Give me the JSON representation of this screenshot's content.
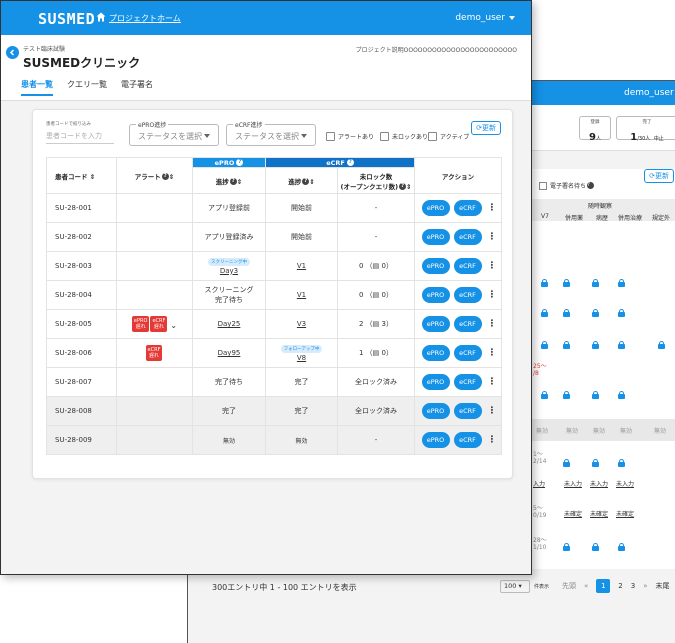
{
  "back": {
    "user": "demo_user",
    "stats": [
      {
        "label": "登録",
        "value": "9",
        "unit": "人"
      },
      {
        "label": "完了",
        "value": "1",
        "sub": "/30",
        "unit": "人"
      },
      {
        "label": "中止",
        "value": "1"
      }
    ],
    "refresh": "更新",
    "sig_pending": "電子署名待ち",
    "observe_header": "随時観察",
    "cols": [
      "併用薬",
      "病歴",
      "併用治療",
      "規定外"
    ],
    "col7": "V7",
    "r1": "25～",
    "r1b": "/8",
    "na": "無効",
    "r2": "1～",
    "r2b": "2/14",
    "r3": "入力",
    "unentered": "未入力",
    "r4": "5～",
    "r4b": "0/19",
    "unconfirmed": "未確定",
    "r5": "28～",
    "r5b": "1/10",
    "dash": "-",
    "footer": {
      "entries": "300エントリ中 1 - 100 エントリを表示",
      "perpage": "100",
      "perpage_label": "件表示",
      "first": "先頭",
      "prev": "«",
      "pages": [
        "1",
        "2",
        "3"
      ],
      "next": "»",
      "last": "末尾"
    }
  },
  "front": {
    "brand": "SUSMED",
    "home": "プロジェクトホーム",
    "user": "demo_user",
    "trial": "テスト臨床試験",
    "clinic": "SUSMEDクリニック",
    "desc": "プロジェクト説明OOOOOOOOOOOOOOOOOOOOOOOO",
    "tabs": [
      "患者一覧",
      "クエリ一覧",
      "電子署名"
    ],
    "filters": {
      "code_label": "患者コードで絞り込み",
      "code_ph": "患者コードを入力",
      "epro_label": "ePRO進捗",
      "epro_ph": "ステータスを選択",
      "ecrf_label": "eCRF進捗",
      "ecrf_ph": "ステータスを選択",
      "checks": [
        "アラートあり",
        "未ロックあり",
        "アクティブ"
      ],
      "refresh": "更新"
    },
    "table": {
      "h_code": "患者コード ⇕",
      "h_alert": "アラート",
      "h_alert_sort": "⇕",
      "g_epro": "ePRO",
      "g_ecrf": "eCRF",
      "h_progress": "進捗",
      "h_sort": "⇕",
      "h_unlock1": "未ロック数",
      "h_unlock2": "(オープンクエリ数)",
      "h_action": "アクション",
      "btn_epro": "ePRO",
      "btn_ecrf": "eCRF",
      "rows": [
        {
          "code": "SU-28-001",
          "alerts": [],
          "epro": "アプリ登録前",
          "ecrf": "開始前",
          "unlock": "-"
        },
        {
          "code": "SU-28-002",
          "alerts": [],
          "epro": "アプリ登録済み",
          "ecrf": "開始前",
          "unlock": "-"
        },
        {
          "code": "SU-28-003",
          "alerts": [],
          "epro_tag": "スクリーニング中",
          "epro": "Day3",
          "ecrf": "V1",
          "unlock": "0 （▤ 0）"
        },
        {
          "code": "SU-28-004",
          "alerts": [],
          "epro": "スクリーニング",
          "epro2": "完了待ち",
          "ecrf": "V1",
          "unlock": "0 （▤ 0）"
        },
        {
          "code": "SU-28-005",
          "alerts": [
            {
              "a": "ePRO",
              "b": "遅れ"
            },
            {
              "a": "eCRF",
              "b": "遅れ"
            }
          ],
          "expand": "⌄",
          "epro": "Day25",
          "ecrf": "V3",
          "unlock": "2 （▤ 3）"
        },
        {
          "code": "SU-28-006",
          "alerts": [
            {
              "a": "eCRF",
              "b": "遅れ"
            }
          ],
          "epro": "Day95",
          "ecrf_tag": "フォローアップ中",
          "ecrf": "V8",
          "unlock": "1 （▤ 0）"
        },
        {
          "code": "SU-28-007",
          "alerts": [],
          "epro": "完了待ち",
          "ecrf": "完了",
          "unlock": "全ロック済み"
        },
        {
          "code": "SU-28-008",
          "alerts": [],
          "epro": "完了",
          "ecrf": "完了",
          "unlock": "全ロック済み",
          "done": true
        },
        {
          "code": "SU-28-009",
          "alerts": [],
          "epro": "無効",
          "ecrf": "無効",
          "unlock": "-",
          "done": true
        }
      ]
    }
  }
}
